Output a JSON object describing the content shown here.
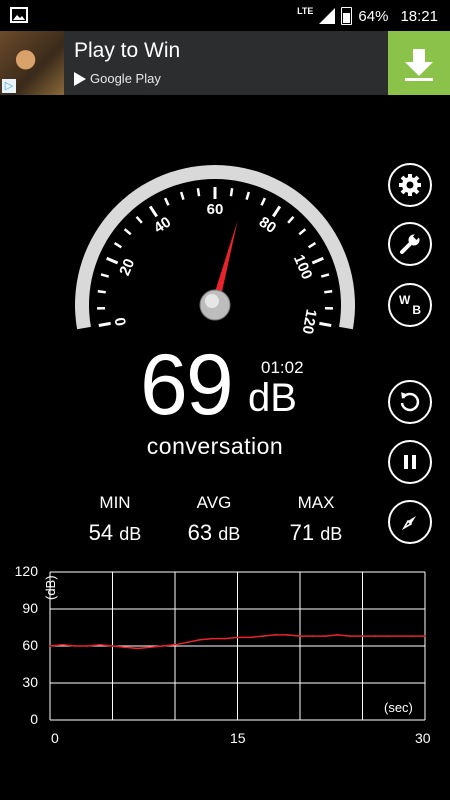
{
  "status": {
    "network": "LTE",
    "battery": "64%",
    "time": "18:21",
    "icons": [
      "gallery-icon",
      "signal-icon",
      "battery-icon"
    ]
  },
  "ad": {
    "title": "Play to Win",
    "store": "Google Play",
    "icons": [
      "ad-choices-icon",
      "download-icon"
    ],
    "button_color": "#8bc34a"
  },
  "gauge": {
    "ticks": [
      "0",
      "20",
      "40",
      "60",
      "80",
      "100",
      "120"
    ],
    "needle_value": 69,
    "min": 0,
    "max": 120,
    "needle_color": "#e8232b"
  },
  "readout": {
    "value": "69",
    "unit": "dB",
    "elapsed": "01:02",
    "category": "conversation"
  },
  "stats": [
    {
      "label": "MIN",
      "value": "54",
      "unit": "dB"
    },
    {
      "label": "AVG",
      "value": "63",
      "unit": "dB"
    },
    {
      "label": "MAX",
      "value": "71",
      "unit": "dB"
    }
  ],
  "side_buttons": [
    "settings-icon",
    "wrench-icon",
    "wb-icon",
    "reset-icon",
    "pause-icon",
    "compass-icon"
  ],
  "wb": {
    "w": "W",
    "b": "B"
  },
  "chart_data": {
    "type": "line",
    "ylabel": "(dB)",
    "xlabel": "(sec)",
    "yticks": [
      "120",
      "90",
      "60",
      "30",
      "0"
    ],
    "xticks": [
      "0",
      "15",
      "30"
    ],
    "ylim": [
      0,
      120
    ],
    "xlim": [
      0,
      30
    ],
    "grid": true,
    "series": [
      {
        "color": "#e8232b",
        "x": [
          0,
          1,
          2,
          3,
          4,
          5,
          6,
          7,
          8,
          9,
          10,
          11,
          12,
          13,
          14,
          15,
          16,
          17,
          18,
          19,
          20,
          21,
          22,
          23,
          24,
          25,
          26,
          27,
          28,
          29,
          30
        ],
        "values": [
          60,
          61,
          60,
          60,
          61,
          60,
          59,
          58,
          59,
          60,
          61,
          63,
          65,
          66,
          66,
          67,
          67,
          68,
          69,
          69,
          68,
          68,
          68,
          69,
          68,
          68,
          68,
          68,
          68,
          68,
          68
        ]
      }
    ]
  }
}
